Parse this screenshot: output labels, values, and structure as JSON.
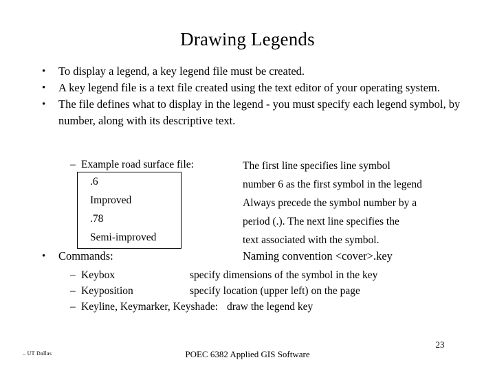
{
  "slide": {
    "title": "Drawing Legends",
    "bullets": [
      {
        "marker": "•",
        "text": "To display a legend, a key legend file must be created."
      },
      {
        "marker": "•",
        "text": "A key legend file is a text file created using the text editor of your operating system."
      },
      {
        "marker": "•",
        "text": "The file defines what to display in the legend - you must specify each legend symbol, by number, along with its descriptive text."
      }
    ],
    "example": {
      "dash": "–",
      "label": "Example road surface file:",
      "code_lines": [
        ".6",
        "Improved",
        ".78",
        "Semi-improved"
      ],
      "notes": [
        "The first line specifies line symbol",
        "number 6 as the first symbol in the legend",
        "Always precede the symbol number by a",
        "period (.).  The next line specifies the",
        "text associated with the symbol."
      ]
    },
    "commands": {
      "marker": "•",
      "label": "Commands:",
      "note": "Naming convention <cover>.key",
      "items": [
        {
          "dash": "–",
          "name": "Keybox",
          "desc": "specify dimensions of the symbol in the key",
          "wide": false
        },
        {
          "dash": "–",
          "name": "Keyposition",
          "desc": "specify location (upper left) on the page",
          "wide": false
        },
        {
          "dash": "–",
          "name": "Keyline, Keymarker, Keyshade:",
          "desc": "draw the legend key",
          "wide": true
        }
      ]
    },
    "footer": {
      "left": "– UT Dallas",
      "center": "POEC 6382 Applied GIS Software",
      "page": "23"
    }
  }
}
